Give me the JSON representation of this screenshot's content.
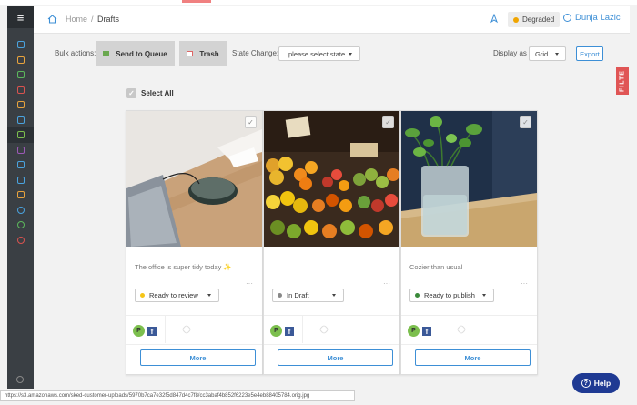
{
  "header": {
    "breadcrumb_home": "Home",
    "breadcrumb_sep": "/",
    "breadcrumb_current": "Drafts",
    "status_label": "Degraded",
    "user_name": "Dunja Lazic"
  },
  "sidebar": {
    "menu_glyph": "≡",
    "icons": [
      "home-icon",
      "upload-icon",
      "calendar-icon",
      "photo-icon",
      "analytics-icon",
      "list-icon",
      "drafts-icon",
      "inbox-icon",
      "messages-icon",
      "users-icon",
      "layers-icon",
      "account-icon",
      "play-icon",
      "alert-icon"
    ]
  },
  "toolbar": {
    "bulk_label": "Bulk actions:",
    "send_to_queue": "Send to Queue",
    "trash": "Trash",
    "state_change_label": "State Change:",
    "state_placeholder": "please select state",
    "display_as_label": "Display as",
    "display_value": "Grid",
    "export": "Export"
  },
  "filter_tab": "FILTE",
  "select_all": "Select All",
  "cards": [
    {
      "caption": "The office is super tidy today ✨",
      "status": "Ready to review",
      "status_color": "#f5c518",
      "more": "More",
      "avatar": "P",
      "network": "f"
    },
    {
      "caption": "",
      "status": "In Draft",
      "status_color": "#888888",
      "more": "More",
      "avatar": "P",
      "network": "f"
    },
    {
      "caption": "Cozier than usual",
      "status": "Ready to publish",
      "status_color": "#3a8a3a",
      "more": "More",
      "avatar": "P",
      "network": "f"
    }
  ],
  "status_url": "https://s3.amazonaws.com/sked-customer-uploads/5970b7ca7e32f5d847d4c7f8/cc3abaf4b852f6223e5e4eb88405784.orig.jpg",
  "help": "Help"
}
